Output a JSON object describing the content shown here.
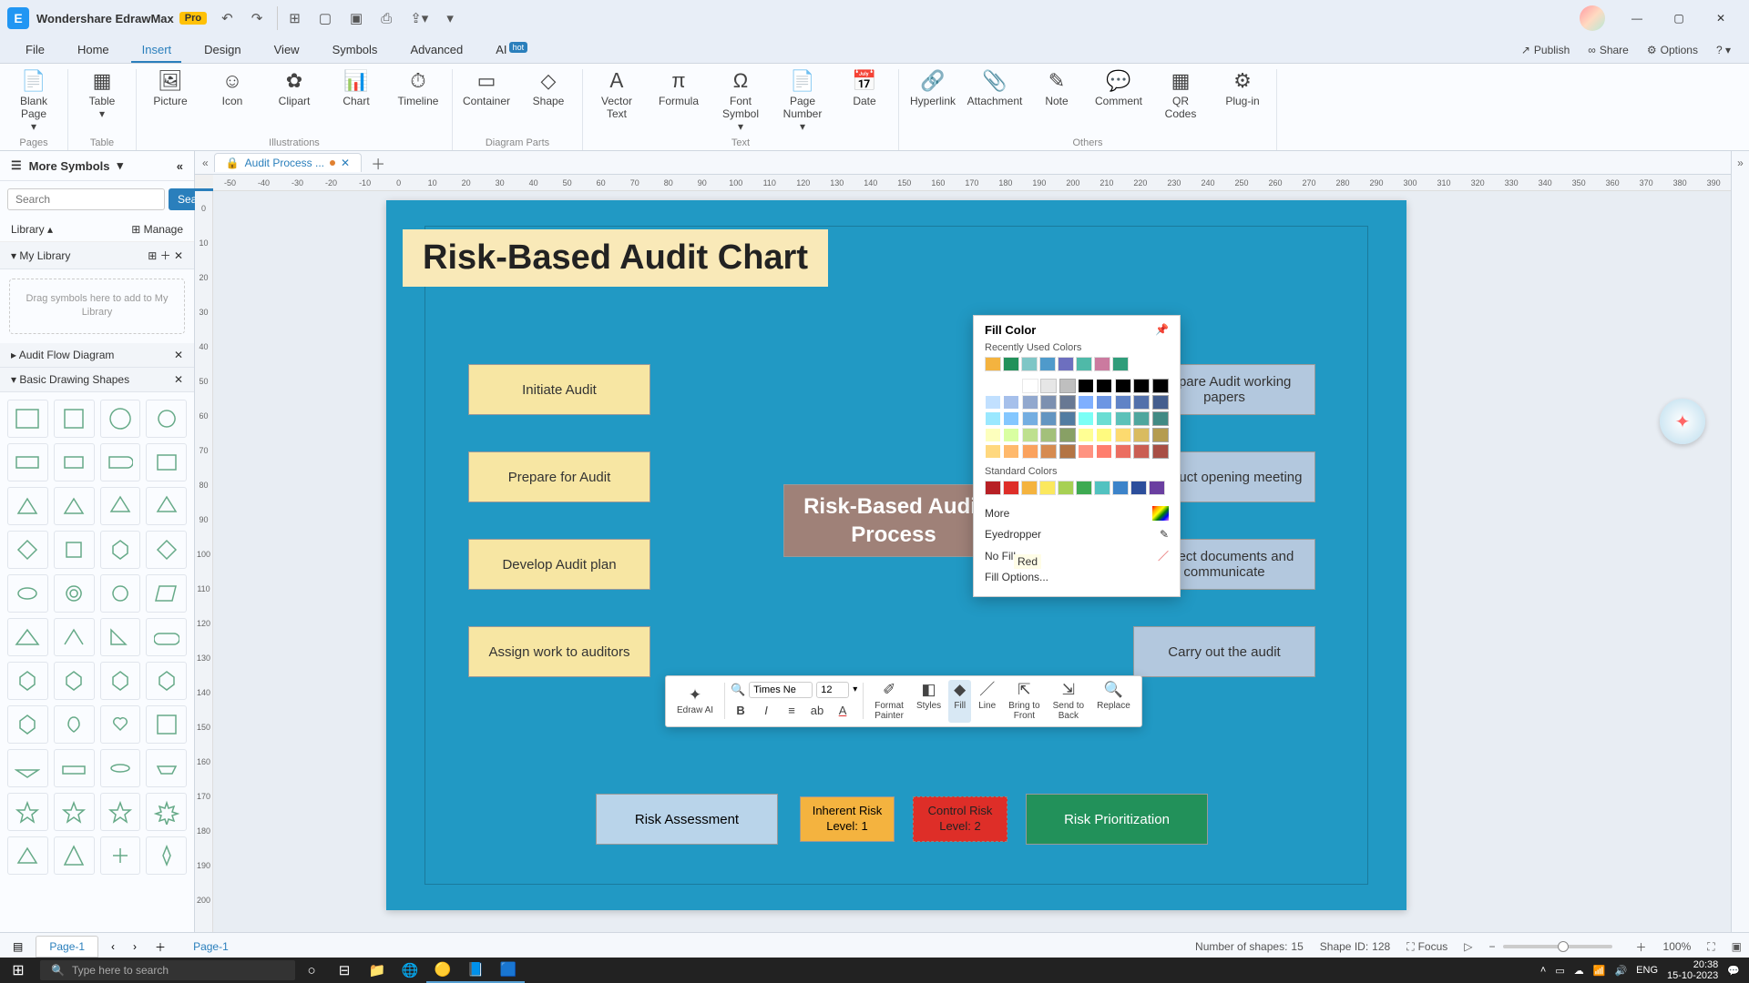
{
  "app": {
    "title": "Wondershare EdrawMax",
    "badge": "Pro"
  },
  "menu": {
    "items": [
      "File",
      "Home",
      "Insert",
      "Design",
      "View",
      "Symbols",
      "Advanced",
      "AI"
    ],
    "active_index": 2,
    "right": {
      "publish": "Publish",
      "share": "Share",
      "options": "Options"
    }
  },
  "ribbon": {
    "groups": [
      {
        "label": "Pages",
        "btns": [
          {
            "icon": "📄",
            "label": "Blank Page ▾"
          }
        ]
      },
      {
        "label": "Table",
        "btns": [
          {
            "icon": "▦",
            "label": "Table ▾"
          }
        ]
      },
      {
        "label": "Illustrations",
        "btns": [
          {
            "icon": "🖼",
            "label": "Picture"
          },
          {
            "icon": "☺",
            "label": "Icon"
          },
          {
            "icon": "✿",
            "label": "Clipart"
          },
          {
            "icon": "📊",
            "label": "Chart"
          },
          {
            "icon": "⏱",
            "label": "Timeline"
          }
        ]
      },
      {
        "label": "Diagram Parts",
        "btns": [
          {
            "icon": "▭",
            "label": "Container"
          },
          {
            "icon": "◇",
            "label": "Shape"
          }
        ]
      },
      {
        "label": "Text",
        "btns": [
          {
            "icon": "Ａ",
            "label": "Vector Text"
          },
          {
            "icon": "π",
            "label": "Formula"
          },
          {
            "icon": "Ω",
            "label": "Font Symbol ▾"
          },
          {
            "icon": "📄",
            "label": "Page Number ▾"
          },
          {
            "icon": "📅",
            "label": "Date"
          }
        ]
      },
      {
        "label": "Others",
        "btns": [
          {
            "icon": "🔗",
            "label": "Hyperlink"
          },
          {
            "icon": "📎",
            "label": "Attachment"
          },
          {
            "icon": "✎",
            "label": "Note"
          },
          {
            "icon": "💬",
            "label": "Comment"
          },
          {
            "icon": "▦",
            "label": "QR Codes"
          },
          {
            "icon": "⚙",
            "label": "Plug-in"
          }
        ]
      }
    ]
  },
  "sidebar": {
    "title": "More Symbols",
    "search_placeholder": "Search",
    "search_btn": "Search",
    "library_label": "Library",
    "manage_label": "Manage",
    "sections": {
      "mylib": {
        "title": "My Library",
        "hint": "Drag symbols here to add to My Library"
      },
      "audit": {
        "title": "Audit Flow Diagram"
      },
      "basic": {
        "title": "Basic Drawing Shapes"
      }
    }
  },
  "doc_tab": {
    "name": "Audit Process ...",
    "unsaved": true
  },
  "canvas": {
    "chart_title": "Risk-Based Audit Chart",
    "left_boxes": [
      "Initiate Audit",
      "Prepare for Audit",
      "Develop Audit plan",
      "Assign work to auditors"
    ],
    "center": "Risk-Based Audit Process",
    "right_boxes": [
      "Prepare Audit working papers",
      "Conduct opening meeting",
      "Collect documents and communicate",
      "Carry out the audit"
    ],
    "bottom": {
      "assess": "Risk Assessment",
      "inh": "Inherent Risk Level: 1",
      "ctrl": "Control Risk Level: 2",
      "prio": "Risk Prioritization"
    }
  },
  "fill_popup": {
    "title": "Fill Color",
    "recent": "Recently Used Colors",
    "standard": "Standard Colors",
    "more": "More",
    "more_tip": "Red",
    "eyedropper": "Eyedropper",
    "nofill": "No Fill",
    "options": "Fill Options...",
    "recent_colors": [
      "#f4b33f",
      "#22915a",
      "#7fc6c6",
      "#4f9acb",
      "#6d6fbf",
      "#4fb9a8",
      "#cb7a9f",
      "#2f9d7a"
    ],
    "std_colors": [
      "#b72025",
      "#de2e28",
      "#f4b33f",
      "#fbe85e",
      "#a7d054",
      "#3eaa52",
      "#52c2c0",
      "#3c83c9",
      "#2c4e9b",
      "#6a3fa0"
    ],
    "theme_grid_cols": [
      "#ffffff",
      "#000000",
      "#8aa0c4",
      "#5b7dbd",
      "#6ea6d6",
      "#58b8b0",
      "#b5d587",
      "#f1d06a",
      "#ee9a5a",
      "#e0695c"
    ]
  },
  "float_tb": {
    "ai": "Edraw AI",
    "font": "Times Ne",
    "size": "12",
    "btns": [
      {
        "ic": "✐",
        "l1": "Format",
        "l2": "Painter"
      },
      {
        "ic": "◧",
        "l1": "Styles",
        "l2": ""
      },
      {
        "ic": "◆",
        "l1": "Fill",
        "l2": ""
      },
      {
        "ic": "／",
        "l1": "Line",
        "l2": ""
      },
      {
        "ic": "⇱",
        "l1": "Bring to",
        "l2": "Front"
      },
      {
        "ic": "⇲",
        "l1": "Send to",
        "l2": "Back"
      },
      {
        "ic": "🔍",
        "l1": "Replace",
        "l2": ""
      }
    ],
    "active_index": 2
  },
  "page_tabs": {
    "page": "Page-1",
    "page2": "Page-1",
    "shapes_lbl": "Number of shapes:",
    "shapes": "15",
    "shapeid_lbl": "Shape ID:",
    "shapeid": "128",
    "focus": "Focus",
    "zoom": "100%"
  },
  "taskbar": {
    "search": "Type here to search",
    "lang": "ENG",
    "time": "20:38",
    "date": "15-10-2023"
  },
  "ruler_marks": [
    "-50",
    "-40",
    "-30",
    "-20",
    "-10",
    "0",
    "10",
    "20",
    "30",
    "40",
    "50",
    "60",
    "70",
    "80",
    "90",
    "100",
    "110",
    "120",
    "130",
    "140",
    "150",
    "160",
    "170",
    "180",
    "190",
    "200",
    "210",
    "220",
    "230",
    "240",
    "250",
    "260",
    "270",
    "280",
    "290",
    "300",
    "310",
    "320",
    "330",
    "340",
    "350",
    "360",
    "370",
    "380",
    "390"
  ],
  "ruler_v": [
    "0",
    "10",
    "20",
    "30",
    "40",
    "50",
    "60",
    "70",
    "80",
    "90",
    "100",
    "110",
    "120",
    "130",
    "140",
    "150",
    "160",
    "170",
    "180",
    "190",
    "200"
  ],
  "quick_colors": [
    "#ffffff",
    "#90171b",
    "#b72025",
    "#d8494e",
    "#e07a8a",
    "#e8a6b3",
    "#333333",
    "#555555",
    "#777777",
    "#eeaa66",
    "#f4b33f",
    "#f0c060",
    "#f7d488",
    "#fbe3b0",
    "#228b5a",
    "#2fa06b",
    "#4fb382",
    "#7cc8a2",
    "#a8dcc2",
    "#6a3fa0",
    "#7f5db5",
    "#9a80c9",
    "#b6a4dc",
    "#d2c8ee",
    "#2c4e9b",
    "#3c6ab4",
    "#558ace",
    "#7eabde",
    "#a8ccee",
    "#b78a2a",
    "#cfa64e",
    "#e0bd7a",
    "#eed5a6",
    "#f6ead2",
    "#666666",
    "#888888",
    "#aaaaaa",
    "#cccccc",
    "#e8e8e8",
    "#d44",
    "#e66",
    "#f88",
    "#faa",
    "#fcc",
    "#46a",
    "#68c",
    "#8ae",
    "#acd",
    "#cef",
    "#953",
    "#a75",
    "#c97",
    "#eb9",
    "#fdb",
    "#2a9",
    "#4cb",
    "#6ed",
    "#9fe",
    "#cff",
    "#333",
    "#555",
    "#777",
    "#999",
    "#bbb",
    "#111",
    "#fff"
  ]
}
